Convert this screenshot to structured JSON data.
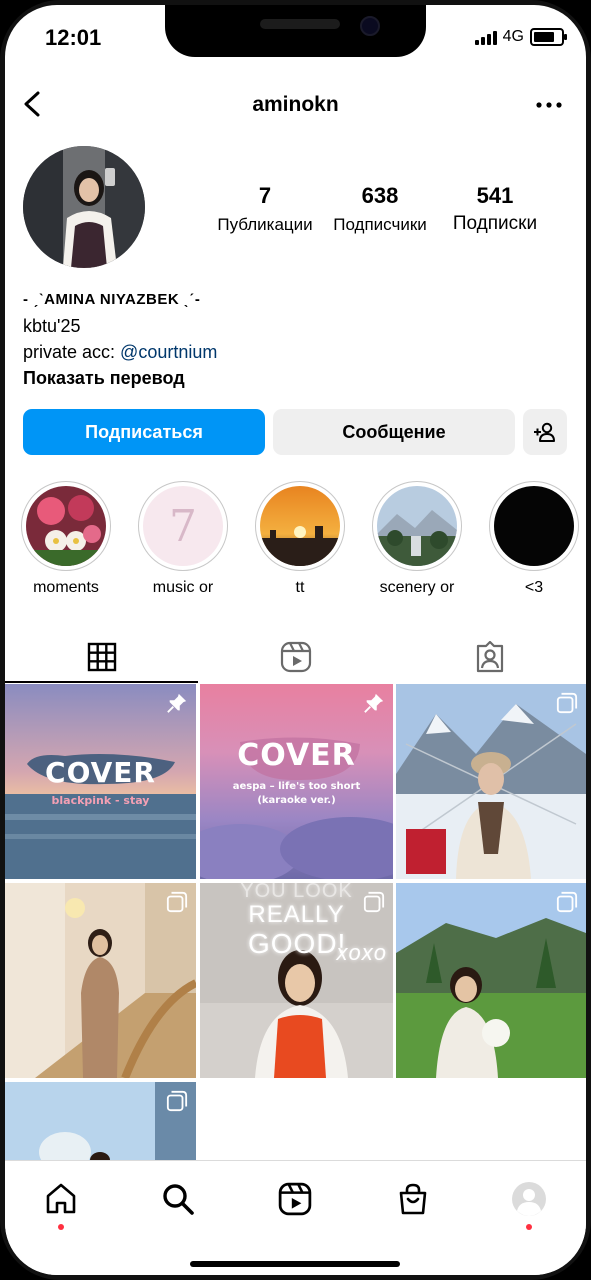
{
  "status": {
    "time": "12:01",
    "network": "4G"
  },
  "header": {
    "username": "aminokn"
  },
  "profile": {
    "stats": [
      {
        "value": "7",
        "label": "Публикации"
      },
      {
        "value": "638",
        "label": "Подписчики"
      },
      {
        "value": "541",
        "label": "Подписки"
      }
    ],
    "name": "- ˏˋAMINA NIYAZBEK ˎˊ-",
    "bio_line1": "kbtu'25",
    "bio_line2_prefix": "private acc: ",
    "bio_line2_link": "@courtnium",
    "translate": "Показать перевод"
  },
  "actions": {
    "follow": "Подписаться",
    "message": "Сообщение"
  },
  "highlights": [
    {
      "label": "moments"
    },
    {
      "label": "music or"
    },
    {
      "label": "tt"
    },
    {
      "label": "scenery or"
    },
    {
      "label": "<3"
    }
  ],
  "posts": {
    "cover1": {
      "title": "COVER",
      "subtitle": "blackpink - stay"
    },
    "cover2": {
      "title": "COVER",
      "subtitle": "aespa – life's too short",
      "subtitle2": "(karaoke ver.)"
    },
    "neon": {
      "line1": "YOU LOOK",
      "line2": "REALLY",
      "line3": "GOOD!",
      "line4": "xoxo"
    },
    "highlight_number": "7"
  },
  "colors": {
    "accent": "#0095f6",
    "link": "#00376b",
    "notification": "#ff3040"
  },
  "icons": {
    "tab1": "grid-icon",
    "tab2": "reels-icon",
    "tab3": "tagged-icon"
  }
}
